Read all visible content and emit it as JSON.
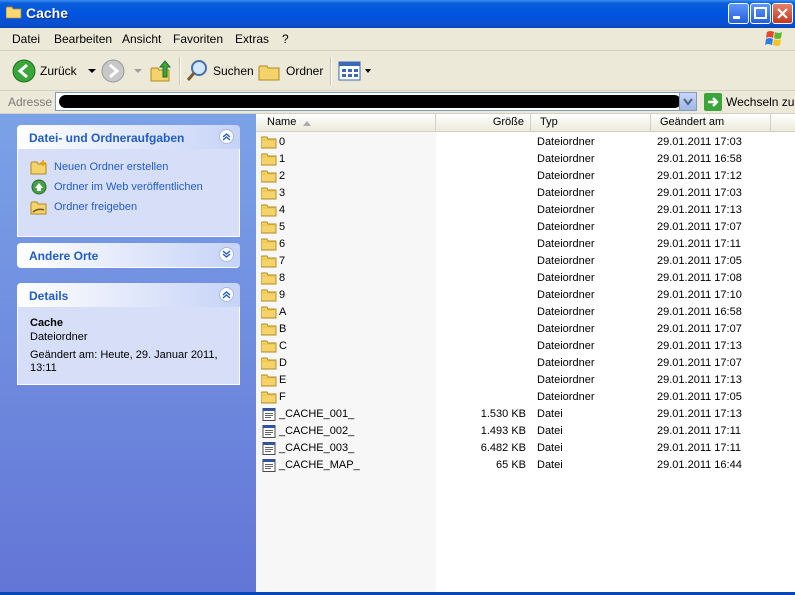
{
  "window": {
    "title": "Cache"
  },
  "menu": [
    "Datei",
    "Bearbeiten",
    "Ansicht",
    "Favoriten",
    "Extras",
    "?"
  ],
  "toolbar": {
    "back_label": "Zurück",
    "search_label": "Suchen",
    "folders_label": "Ordner"
  },
  "address": {
    "label": "Adresse",
    "value": "",
    "go_label": "Wechseln zu"
  },
  "sidebar": {
    "tasks": {
      "title": "Datei- und Ordneraufgaben",
      "items": [
        "Neuen Ordner erstellen",
        "Ordner im Web veröffentlichen",
        "Ordner freigeben"
      ]
    },
    "other_places": {
      "title": "Andere Orte"
    },
    "details": {
      "title": "Details",
      "name": "Cache",
      "type": "Dateiordner",
      "modified": "Geändert am: Heute, 29. Januar 2011, 13:11"
    }
  },
  "files": {
    "columns": {
      "name": "Name",
      "size": "Größe",
      "type": "Typ",
      "modified": "Geändert am"
    },
    "rows": [
      {
        "name": "0",
        "size": "",
        "type": "Dateiordner",
        "modified": "29.01.2011 17:03",
        "kind": "folder"
      },
      {
        "name": "1",
        "size": "",
        "type": "Dateiordner",
        "modified": "29.01.2011 16:58",
        "kind": "folder"
      },
      {
        "name": "2",
        "size": "",
        "type": "Dateiordner",
        "modified": "29.01.2011 17:12",
        "kind": "folder"
      },
      {
        "name": "3",
        "size": "",
        "type": "Dateiordner",
        "modified": "29.01.2011 17:03",
        "kind": "folder"
      },
      {
        "name": "4",
        "size": "",
        "type": "Dateiordner",
        "modified": "29.01.2011 17:13",
        "kind": "folder"
      },
      {
        "name": "5",
        "size": "",
        "type": "Dateiordner",
        "modified": "29.01.2011 17:07",
        "kind": "folder"
      },
      {
        "name": "6",
        "size": "",
        "type": "Dateiordner",
        "modified": "29.01.2011 17:11",
        "kind": "folder"
      },
      {
        "name": "7",
        "size": "",
        "type": "Dateiordner",
        "modified": "29.01.2011 17:05",
        "kind": "folder"
      },
      {
        "name": "8",
        "size": "",
        "type": "Dateiordner",
        "modified": "29.01.2011 17:08",
        "kind": "folder"
      },
      {
        "name": "9",
        "size": "",
        "type": "Dateiordner",
        "modified": "29.01.2011 17:10",
        "kind": "folder"
      },
      {
        "name": "A",
        "size": "",
        "type": "Dateiordner",
        "modified": "29.01.2011 16:58",
        "kind": "folder"
      },
      {
        "name": "B",
        "size": "",
        "type": "Dateiordner",
        "modified": "29.01.2011 17:07",
        "kind": "folder"
      },
      {
        "name": "C",
        "size": "",
        "type": "Dateiordner",
        "modified": "29.01.2011 17:13",
        "kind": "folder"
      },
      {
        "name": "D",
        "size": "",
        "type": "Dateiordner",
        "modified": "29.01.2011 17:07",
        "kind": "folder"
      },
      {
        "name": "E",
        "size": "",
        "type": "Dateiordner",
        "modified": "29.01.2011 17:13",
        "kind": "folder"
      },
      {
        "name": "F",
        "size": "",
        "type": "Dateiordner",
        "modified": "29.01.2011 17:05",
        "kind": "folder"
      },
      {
        "name": "_CACHE_001_",
        "size": "1.530 KB",
        "type": "Datei",
        "modified": "29.01.2011 17:13",
        "kind": "file"
      },
      {
        "name": "_CACHE_002_",
        "size": "1.493 KB",
        "type": "Datei",
        "modified": "29.01.2011 17:11",
        "kind": "file"
      },
      {
        "name": "_CACHE_003_",
        "size": "6.482 KB",
        "type": "Datei",
        "modified": "29.01.2011 17:11",
        "kind": "file"
      },
      {
        "name": "_CACHE_MAP_",
        "size": "65 KB",
        "type": "Datei",
        "modified": "29.01.2011 16:44",
        "kind": "file"
      }
    ]
  },
  "colors": {
    "titlebar": "#0054e3",
    "sidebar_top": "#7ba2e7",
    "sidebar_bottom": "#6375d6",
    "link": "#215dc6"
  }
}
